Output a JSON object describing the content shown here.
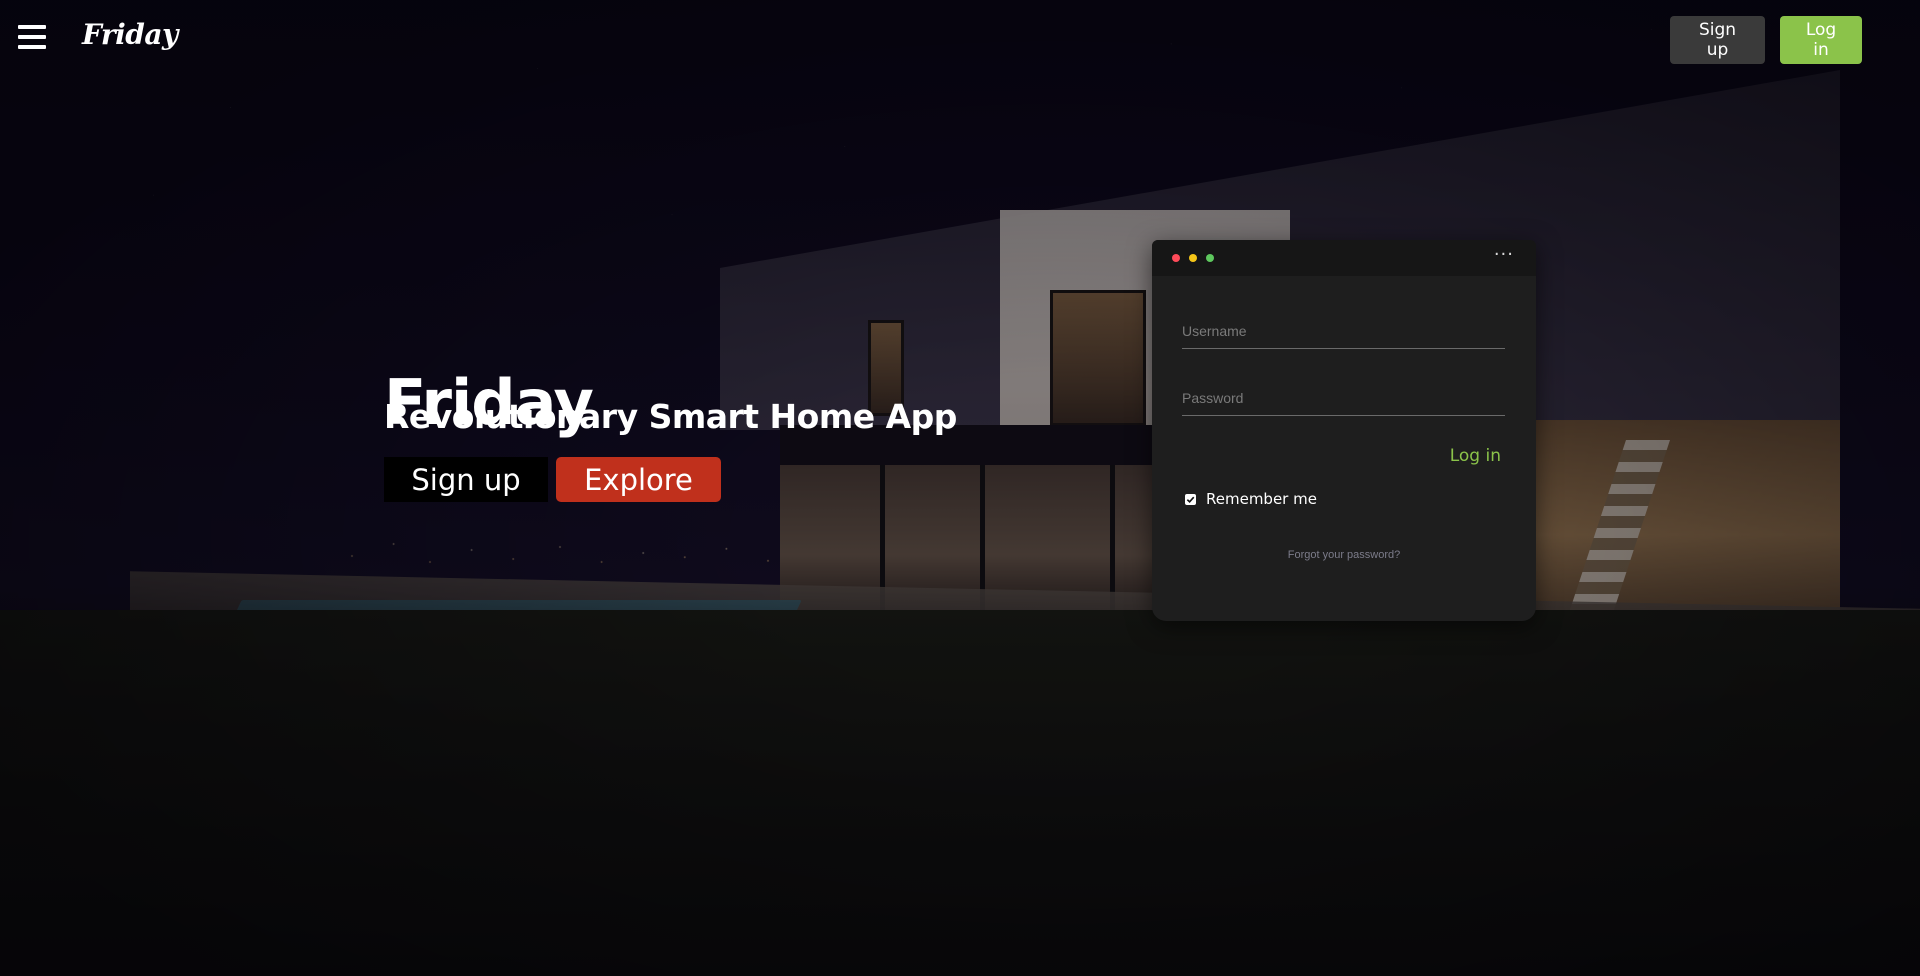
{
  "header": {
    "brand": "Friday",
    "signup_label": "Sign up",
    "login_label": "Log in"
  },
  "hero": {
    "title": "Friday",
    "subtitle": "Revolutionary Smart Home App",
    "signup_label": "Sign up",
    "explore_label": "Explore"
  },
  "login_form": {
    "menu_glyph": "···",
    "username_placeholder": "Username",
    "password_placeholder": "Password",
    "submit_label": "Log in",
    "remember_label": "Remember me",
    "remember_checked": true,
    "forgot_label": "Forgot your password?"
  },
  "colors": {
    "accent_green": "#8bc34a",
    "explore_red": "#c0301c",
    "dot_red": "#ff4b5a",
    "dot_yellow": "#f5c518",
    "dot_green": "#5ec85e"
  }
}
